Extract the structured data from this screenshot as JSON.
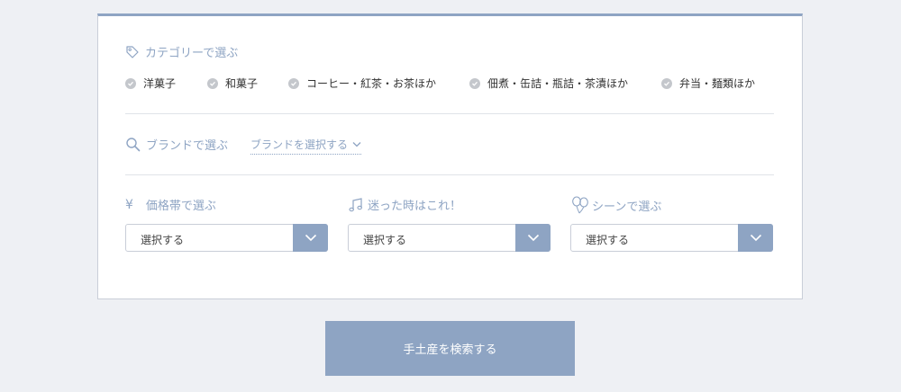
{
  "category": {
    "title": "カテゴリーで選ぶ",
    "items": [
      {
        "label": "洋菓子"
      },
      {
        "label": "和菓子"
      },
      {
        "label": "コーヒー・紅茶・お茶ほか"
      },
      {
        "label": "佃煮・缶詰・瓶詰・茶漬ほか"
      },
      {
        "label": "弁当・麺類ほか"
      }
    ]
  },
  "brand": {
    "title": "ブランドで選ぶ",
    "select_label": "ブランドを選択する"
  },
  "filters": [
    {
      "title": "価格帯で選ぶ",
      "icon": "yen-icon",
      "yen": "¥",
      "value": "選択する"
    },
    {
      "title": "迷った時はこれ！",
      "icon": "music-note-icon",
      "value": "選択する"
    },
    {
      "title": "シーンで選ぶ",
      "icon": "balloons-icon",
      "value": "選択する"
    }
  ],
  "search_button": "手土産を検索する",
  "colors": {
    "accent": "#8ea4c3",
    "background": "#eef0f4",
    "check": "#c4c7cc"
  }
}
